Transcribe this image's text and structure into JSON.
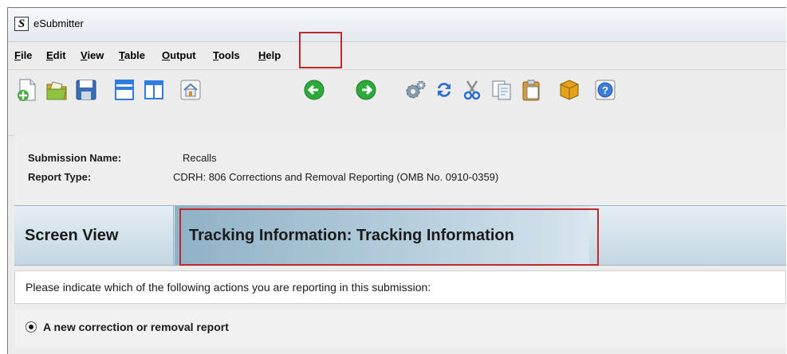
{
  "window": {
    "title": "eSubmitter",
    "app_icon_letter": "S"
  },
  "menu": [
    {
      "label": "File",
      "mnemonic": "F",
      "rest": "ile"
    },
    {
      "label": "Edit",
      "mnemonic": "E",
      "rest": "dit"
    },
    {
      "label": "View",
      "mnemonic": "V",
      "rest": "iew"
    },
    {
      "label": "Table",
      "mnemonic": "T",
      "rest": "able"
    },
    {
      "label": "Output",
      "mnemonic": "O",
      "rest": "utput"
    },
    {
      "label": "Tools",
      "mnemonic": "T",
      "rest": "ools"
    },
    {
      "label": "Help",
      "mnemonic": "H",
      "rest": "elp"
    }
  ],
  "toolbar": {
    "icons": [
      "new-document-icon",
      "open-folder-icon",
      "save-icon",
      "window-cascade-icon",
      "window-split-icon",
      "home-icon",
      "back-arrow-icon",
      "forward-arrow-icon",
      "settings-gears-icon",
      "refresh-icon",
      "cut-icon",
      "copy-icon",
      "paste-icon",
      "package-icon",
      "help-icon"
    ],
    "highlighted": "back-arrow-icon",
    "highlight_color": "#c0282c"
  },
  "submission": {
    "name_label": "Submission Name:",
    "name_value": "Recalls",
    "type_label": "Report Type:",
    "type_value": "CDRH: 806 Corrections and Removal Reporting (OMB No. 0910-0359)"
  },
  "header": {
    "screen_view": "Screen View",
    "tracking_title": "Tracking Information: Tracking Information"
  },
  "question": {
    "text": "Please indicate which of the following actions you are reporting in this submission:",
    "option_label": "A new correction or removal report",
    "option_selected": true
  },
  "colors": {
    "highlight": "#c0282c",
    "header_blue": "#a9c5d5",
    "green_arrow": "#2eaa3a"
  }
}
